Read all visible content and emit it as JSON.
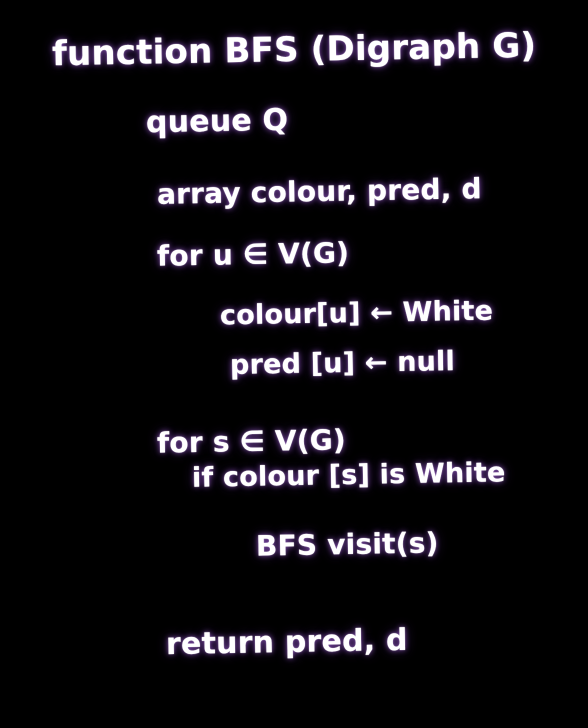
{
  "board": {
    "background": "#000000",
    "ink_color": "#ffffff",
    "glow_color": "#b36bff",
    "lines": [
      "function BFS (Digraph G)",
      "queue Q",
      "array colour, pred, d",
      "for u ∈ V(G)",
      "colour[u] ← White",
      "pred [u] ← null",
      "for s ∈ V(G)",
      "if colour [s] is White",
      "BFS visit(s)",
      "return pred, d"
    ]
  }
}
